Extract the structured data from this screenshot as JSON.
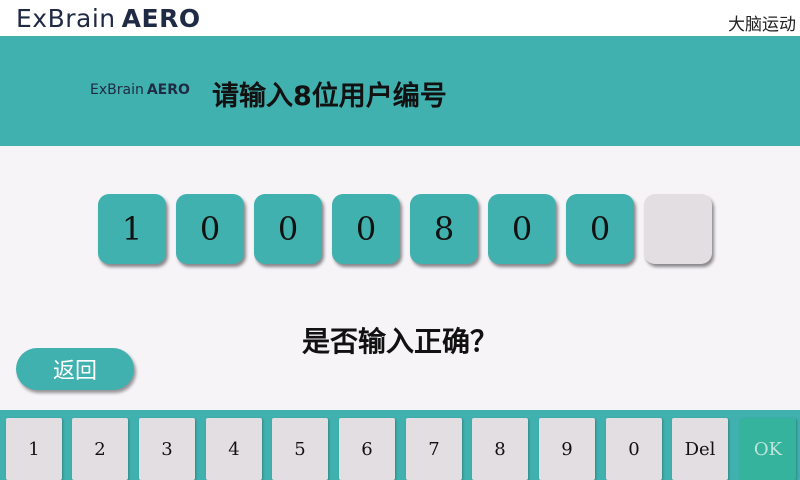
{
  "header": {
    "logo_word": "ExBrain",
    "logo_bold": "AERO",
    "app_name": "大脑运动"
  },
  "banner": {
    "logo_word": "ExBrain",
    "logo_bold": "AERO",
    "title": "请输入8位用户编号"
  },
  "entry": {
    "digits": [
      "1",
      "0",
      "0",
      "0",
      "8",
      "0",
      "0",
      ""
    ]
  },
  "prompt": "是否输入正确？",
  "back_label": "返回",
  "keypad": {
    "keys": [
      "1",
      "2",
      "3",
      "4",
      "5",
      "6",
      "7",
      "8",
      "9",
      "0",
      "Del",
      "OK"
    ],
    "ok_color": "#35b39c"
  },
  "colors": {
    "accent": "#40b1af",
    "background": "#f7f4f8",
    "key": "#e3dee2"
  }
}
